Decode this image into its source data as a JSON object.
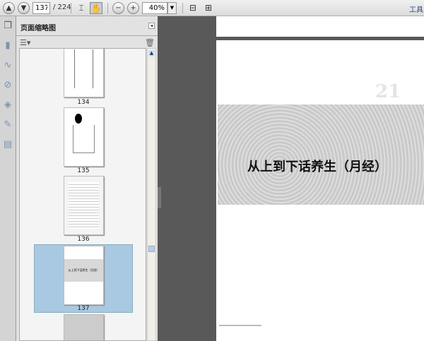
{
  "toolbar": {
    "page_current": "137",
    "page_total": "/ 224",
    "zoom": "40%",
    "tools_label": "工具"
  },
  "panel": {
    "title": "页面缩略图"
  },
  "thumbnails": [
    {
      "label": "134"
    },
    {
      "label": "135"
    },
    {
      "label": "136"
    },
    {
      "label": "137",
      "selected": true
    }
  ],
  "document": {
    "chapter_number": "21",
    "chapter_title": "从上到下话养生（月经）"
  },
  "colors": {
    "selection": "#a9c9e3",
    "canvas": "#595959"
  }
}
